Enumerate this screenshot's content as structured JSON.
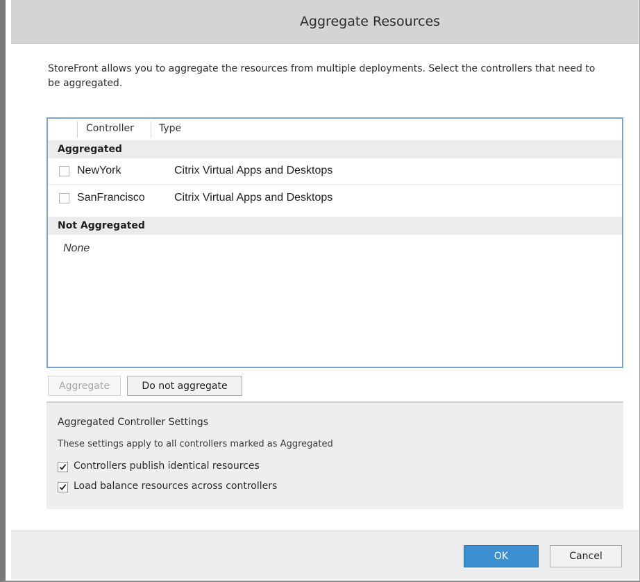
{
  "window": {
    "title": "Aggregate Resources"
  },
  "description": "StoreFront allows you to aggregate the resources from multiple deployments. Select the controllers that need to be aggregated.",
  "table": {
    "columns": [
      "Controller",
      "Type"
    ],
    "groups": [
      {
        "label": "Aggregated",
        "rows": [
          {
            "controller": "NewYork",
            "type": "Citrix Virtual Apps and Desktops",
            "checked": false
          },
          {
            "controller": "SanFrancisco",
            "type": "Citrix Virtual Apps and Desktops",
            "checked": false
          }
        ]
      },
      {
        "label": "Not Aggregated",
        "empty_text": "None"
      }
    ]
  },
  "list_buttons": {
    "aggregate": "Aggregate",
    "do_not_aggregate": "Do not aggregate"
  },
  "settings": {
    "title": "Aggregated Controller Settings",
    "description": "These settings apply to all controllers marked as Aggregated",
    "options": [
      {
        "label": "Controllers publish identical resources",
        "checked": true
      },
      {
        "label": "Load balance resources across controllers",
        "checked": true
      }
    ]
  },
  "footer": {
    "ok": "OK",
    "cancel": "Cancel"
  },
  "colors": {
    "primary_button": "#3c8fd1",
    "list_border": "#7aa4c8",
    "title_bar": "#d4d4d4"
  }
}
